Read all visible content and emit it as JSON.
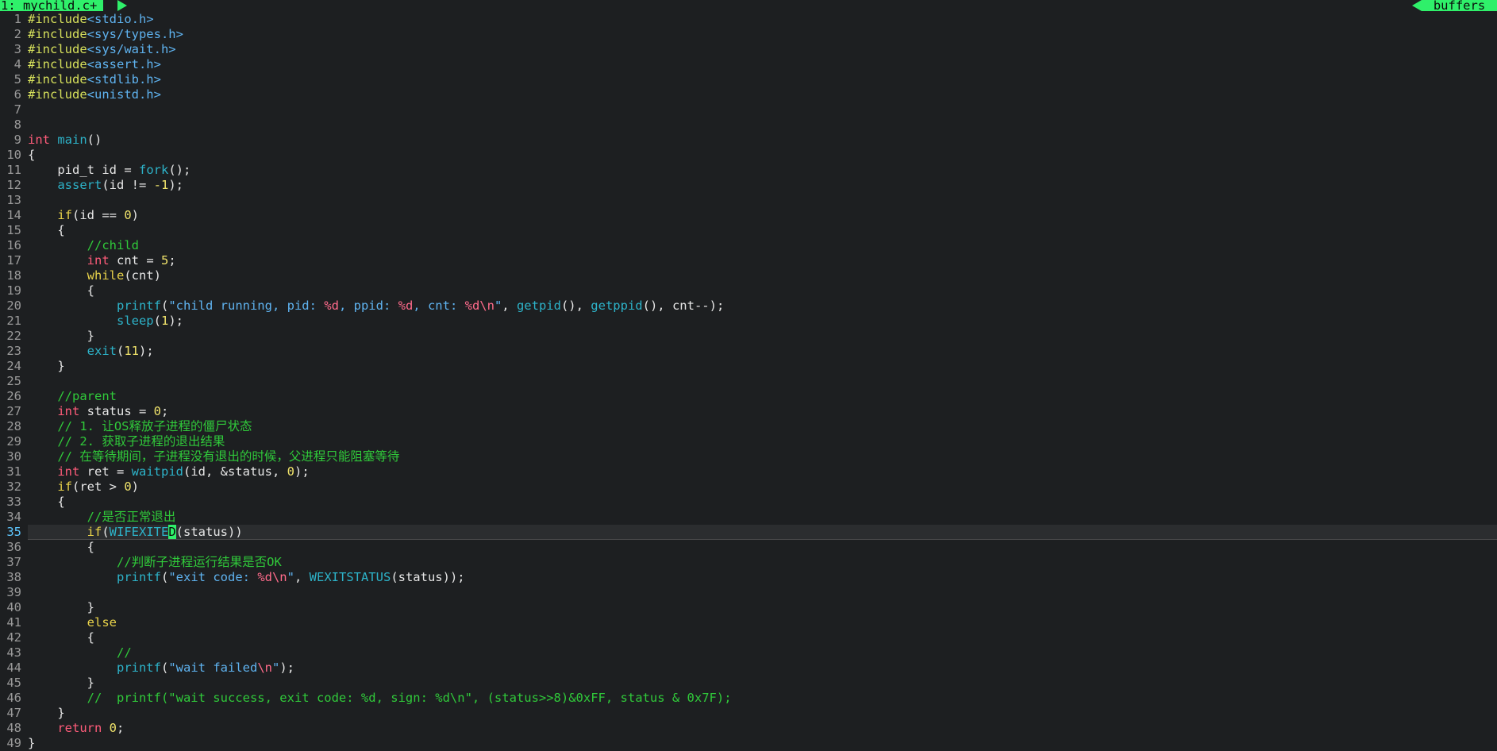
{
  "tabline": {
    "tab_label": "1: mychild.c+",
    "buffers_label": "buffers"
  },
  "colors": {
    "accent_green": "#2ff06a",
    "background": "#1d1f21",
    "preprocessor": "#d6e05b",
    "type_keyword": "#ff5c7a",
    "function": "#2db3c9",
    "number": "#f0e36b",
    "control": "#e8d24a",
    "comment": "#30c93a",
    "string": "#5fb3f0",
    "format_spec": "#ff6b8b"
  },
  "editor": {
    "current_line": 35,
    "lines": [
      {
        "n": "1",
        "parts": [
          [
            "pp",
            "#include"
          ],
          [
            "inc",
            "<stdio.h>"
          ]
        ]
      },
      {
        "n": "2",
        "parts": [
          [
            "pp",
            "#include"
          ],
          [
            "inc",
            "<sys/types.h>"
          ]
        ]
      },
      {
        "n": "3",
        "parts": [
          [
            "pp",
            "#include"
          ],
          [
            "inc",
            "<sys/wait.h>"
          ]
        ]
      },
      {
        "n": "4",
        "parts": [
          [
            "pp",
            "#include"
          ],
          [
            "inc",
            "<assert.h>"
          ]
        ]
      },
      {
        "n": "5",
        "parts": [
          [
            "pp",
            "#include"
          ],
          [
            "inc",
            "<stdlib.h>"
          ]
        ]
      },
      {
        "n": "6",
        "parts": [
          [
            "pp",
            "#include"
          ],
          [
            "inc",
            "<unistd.h>"
          ]
        ]
      },
      {
        "n": "7",
        "parts": []
      },
      {
        "n": "8",
        "parts": []
      },
      {
        "n": "9",
        "parts": [
          [
            "type",
            "int"
          ],
          [
            "p",
            " "
          ],
          [
            "func",
            "main"
          ],
          [
            "p",
            "()"
          ]
        ]
      },
      {
        "n": "10",
        "parts": [
          [
            "p",
            "{"
          ]
        ]
      },
      {
        "n": "11",
        "parts": [
          [
            "p",
            "    pid_t id = "
          ],
          [
            "func",
            "fork"
          ],
          [
            "p",
            "();"
          ]
        ]
      },
      {
        "n": "12",
        "parts": [
          [
            "p",
            "    "
          ],
          [
            "func",
            "assert"
          ],
          [
            "p",
            "(id != "
          ],
          [
            "num",
            "-1"
          ],
          [
            "p",
            ");"
          ]
        ]
      },
      {
        "n": "13",
        "parts": []
      },
      {
        "n": "14",
        "parts": [
          [
            "p",
            "    "
          ],
          [
            "ctrl",
            "if"
          ],
          [
            "p",
            "(id == "
          ],
          [
            "num",
            "0"
          ],
          [
            "p",
            ")"
          ]
        ]
      },
      {
        "n": "15",
        "parts": [
          [
            "p",
            "    {"
          ]
        ]
      },
      {
        "n": "16",
        "parts": [
          [
            "p",
            "        "
          ],
          [
            "cmt",
            "//child"
          ]
        ]
      },
      {
        "n": "17",
        "parts": [
          [
            "p",
            "        "
          ],
          [
            "type",
            "int"
          ],
          [
            "p",
            " cnt = "
          ],
          [
            "num",
            "5"
          ],
          [
            "p",
            ";"
          ]
        ]
      },
      {
        "n": "18",
        "parts": [
          [
            "p",
            "        "
          ],
          [
            "ctrl",
            "while"
          ],
          [
            "p",
            "(cnt)"
          ]
        ]
      },
      {
        "n": "19",
        "parts": [
          [
            "p",
            "        {"
          ]
        ]
      },
      {
        "n": "20",
        "parts": [
          [
            "p",
            "            "
          ],
          [
            "func",
            "printf"
          ],
          [
            "p",
            "("
          ],
          [
            "str",
            "\"child running, pid: "
          ],
          [
            "fmt",
            "%d"
          ],
          [
            "str",
            ", ppid: "
          ],
          [
            "fmt",
            "%d"
          ],
          [
            "str",
            ", cnt: "
          ],
          [
            "fmt",
            "%d\\n"
          ],
          [
            "str",
            "\""
          ],
          [
            "p",
            ", "
          ],
          [
            "func",
            "getpid"
          ],
          [
            "p",
            "(), "
          ],
          [
            "func",
            "getppid"
          ],
          [
            "p",
            "(), cnt--);"
          ]
        ]
      },
      {
        "n": "21",
        "parts": [
          [
            "p",
            "            "
          ],
          [
            "func",
            "sleep"
          ],
          [
            "p",
            "("
          ],
          [
            "num",
            "1"
          ],
          [
            "p",
            ");"
          ]
        ]
      },
      {
        "n": "22",
        "parts": [
          [
            "p",
            "        }"
          ]
        ]
      },
      {
        "n": "23",
        "parts": [
          [
            "p",
            "        "
          ],
          [
            "func",
            "exit"
          ],
          [
            "p",
            "("
          ],
          [
            "num",
            "11"
          ],
          [
            "p",
            ");"
          ]
        ]
      },
      {
        "n": "24",
        "parts": [
          [
            "p",
            "    }"
          ]
        ]
      },
      {
        "n": "25",
        "parts": []
      },
      {
        "n": "26",
        "parts": [
          [
            "p",
            "    "
          ],
          [
            "cmt",
            "//parent"
          ]
        ]
      },
      {
        "n": "27",
        "parts": [
          [
            "p",
            "    "
          ],
          [
            "type",
            "int"
          ],
          [
            "p",
            " status = "
          ],
          [
            "num",
            "0"
          ],
          [
            "p",
            ";"
          ]
        ]
      },
      {
        "n": "28",
        "parts": [
          [
            "p",
            "    "
          ],
          [
            "cmt",
            "// 1. 让OS释放子进程的僵尸状态"
          ]
        ]
      },
      {
        "n": "29",
        "parts": [
          [
            "p",
            "    "
          ],
          [
            "cmt",
            "// 2. 获取子进程的退出结果"
          ]
        ]
      },
      {
        "n": "30",
        "parts": [
          [
            "p",
            "    "
          ],
          [
            "cmt",
            "// 在等待期间，子进程没有退出的时候，父进程只能阻塞等待"
          ]
        ]
      },
      {
        "n": "31",
        "parts": [
          [
            "p",
            "    "
          ],
          [
            "type",
            "int"
          ],
          [
            "p",
            " ret = "
          ],
          [
            "func",
            "waitpid"
          ],
          [
            "p",
            "(id, &status, "
          ],
          [
            "num",
            "0"
          ],
          [
            "p",
            ");"
          ]
        ]
      },
      {
        "n": "32",
        "parts": [
          [
            "p",
            "    "
          ],
          [
            "ctrl",
            "if"
          ],
          [
            "p",
            "(ret > "
          ],
          [
            "num",
            "0"
          ],
          [
            "p",
            ")"
          ]
        ]
      },
      {
        "n": "33",
        "parts": [
          [
            "p",
            "    {"
          ]
        ]
      },
      {
        "n": "34",
        "parts": [
          [
            "p",
            "        "
          ],
          [
            "cmt",
            "//是否正常退出"
          ]
        ]
      },
      {
        "n": "35",
        "parts": [
          [
            "p",
            "        "
          ],
          [
            "ctrl",
            "if"
          ],
          [
            "p",
            "("
          ],
          [
            "func",
            "WIFEXITE"
          ],
          [
            "cur",
            "D"
          ],
          [
            "p",
            "(status))"
          ]
        ]
      },
      {
        "n": "36",
        "parts": [
          [
            "p",
            "        {"
          ]
        ]
      },
      {
        "n": "37",
        "parts": [
          [
            "p",
            "            "
          ],
          [
            "cmt",
            "//判断子进程运行结果是否OK"
          ]
        ]
      },
      {
        "n": "38",
        "parts": [
          [
            "p",
            "            "
          ],
          [
            "func",
            "printf"
          ],
          [
            "p",
            "("
          ],
          [
            "str",
            "\"exit code: "
          ],
          [
            "fmt",
            "%d\\n"
          ],
          [
            "str",
            "\""
          ],
          [
            "p",
            ", "
          ],
          [
            "func",
            "WEXITSTATUS"
          ],
          [
            "p",
            "(status));"
          ]
        ]
      },
      {
        "n": "39",
        "parts": []
      },
      {
        "n": "40",
        "parts": [
          [
            "p",
            "        }"
          ]
        ]
      },
      {
        "n": "41",
        "parts": [
          [
            "p",
            "        "
          ],
          [
            "ctrl",
            "else"
          ]
        ]
      },
      {
        "n": "42",
        "parts": [
          [
            "p",
            "        {"
          ]
        ]
      },
      {
        "n": "43",
        "parts": [
          [
            "p",
            "            "
          ],
          [
            "cmt",
            "//"
          ]
        ]
      },
      {
        "n": "44",
        "parts": [
          [
            "p",
            "            "
          ],
          [
            "func",
            "printf"
          ],
          [
            "p",
            "("
          ],
          [
            "str",
            "\"wait failed"
          ],
          [
            "fmt",
            "\\n"
          ],
          [
            "str",
            "\""
          ],
          [
            "p",
            ");"
          ]
        ]
      },
      {
        "n": "45",
        "parts": [
          [
            "p",
            "        }"
          ]
        ]
      },
      {
        "n": "46",
        "parts": [
          [
            "p",
            "        "
          ],
          [
            "cmt",
            "//  printf(\"wait success, exit code: %d, sign: %d\\n\", (status>>8)&0xFF, status & 0x7F);"
          ]
        ]
      },
      {
        "n": "47",
        "parts": [
          [
            "p",
            "    }"
          ]
        ]
      },
      {
        "n": "48",
        "parts": [
          [
            "p",
            "    "
          ],
          [
            "type",
            "return"
          ],
          [
            "p",
            " "
          ],
          [
            "num",
            "0"
          ],
          [
            "p",
            ";"
          ]
        ]
      },
      {
        "n": "49",
        "parts": [
          [
            "p",
            "}"
          ]
        ]
      }
    ]
  }
}
